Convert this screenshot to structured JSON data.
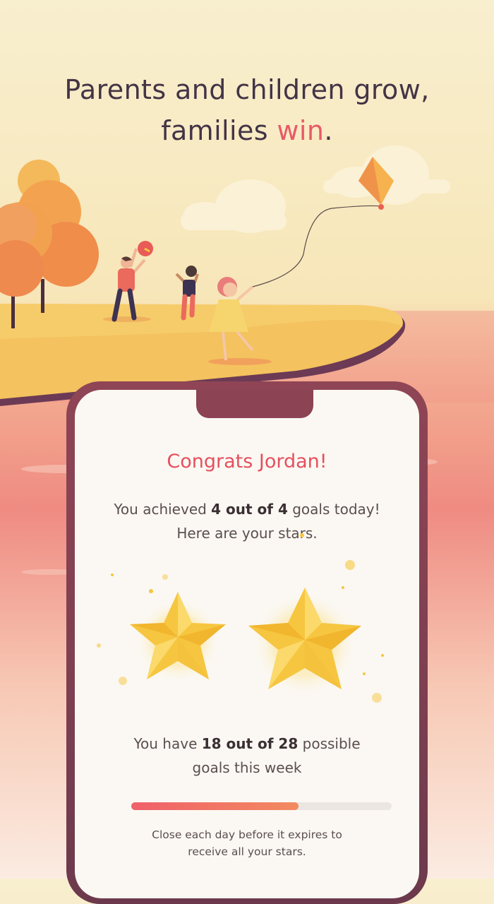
{
  "headline": {
    "line1": "Parents and children grow,",
    "line2_prefix": "families ",
    "line2_accent": "win",
    "line2_suffix": "."
  },
  "card": {
    "title": "Congrats Jordan!",
    "achieved": {
      "prefix": "You achieved ",
      "highlight": "4 out of 4",
      "suffix": " goals today!",
      "line2": "Here are your stars."
    },
    "stars_earned": 2,
    "weekly": {
      "prefix": "You have ",
      "highlight": "18 out of 28",
      "suffix": " possible",
      "line2": "goals this week"
    },
    "progress_fraction": 0.643,
    "footnote_line1": "Close each day before it expires to",
    "footnote_line2": "receive all your stars."
  },
  "colors": {
    "accent": "#e85a67",
    "headline_text": "#433446",
    "phone_frame": "#7d3f51",
    "star_gold": "#f6c640"
  }
}
